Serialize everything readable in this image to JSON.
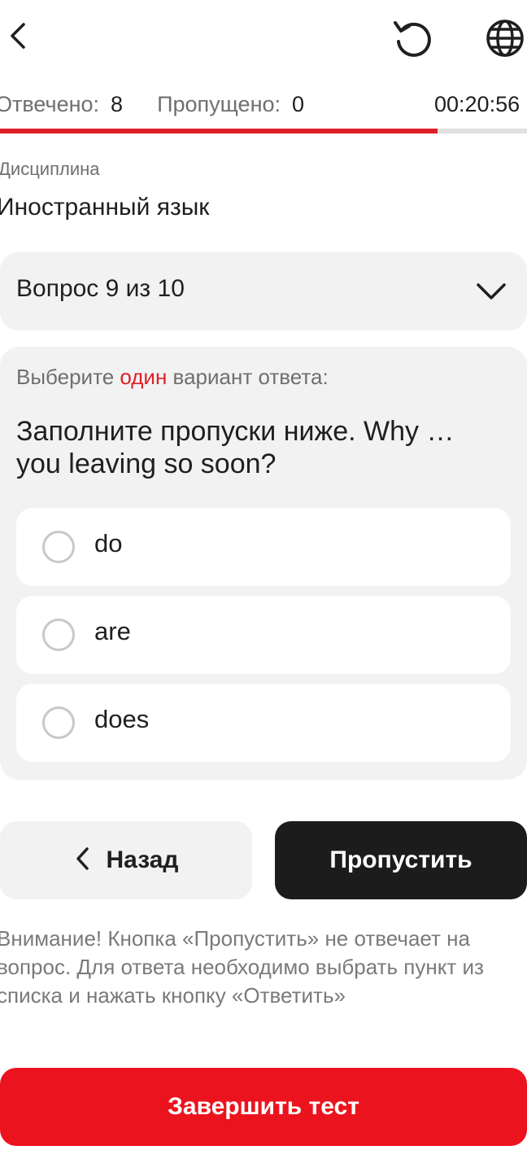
{
  "header": {
    "back_icon": "chevron-left-icon",
    "refresh_icon": "refresh-icon",
    "language_icon": "globe-icon"
  },
  "stats": {
    "answered_label": "Отвечено:",
    "answered_value": "8",
    "skipped_label": "Пропущено:",
    "skipped_value": "0",
    "timer": "00:20:56"
  },
  "progress": {
    "fraction": 0.83,
    "fill_color": "#de1f26",
    "track_color": "#e0e0e0"
  },
  "discipline": {
    "label": "Дисциплина",
    "value": "Иностранный язык"
  },
  "question_selector": {
    "label": "Вопрос 9 из 10"
  },
  "question": {
    "instruction_before": "Выберите ",
    "instruction_accent": "один",
    "instruction_after": " вариант ответа:",
    "text": "Заполните пропуски ниже. Why … you leaving so soon?",
    "options": [
      {
        "label": "do"
      },
      {
        "label": "are"
      },
      {
        "label": "does"
      }
    ]
  },
  "actions": {
    "back_label": "Назад",
    "skip_label": "Пропустить",
    "warning": "Внимание! Кнопка «Пропустить» не отвечает на вопрос. Для ответа необходимо выбрать пункт из списка и нажать кнопку «Ответить»",
    "finish_label": "Завершить тест"
  },
  "colors": {
    "accent": "#de1f26",
    "finish": "#eb141e",
    "dark_button": "#1c1c1c"
  }
}
